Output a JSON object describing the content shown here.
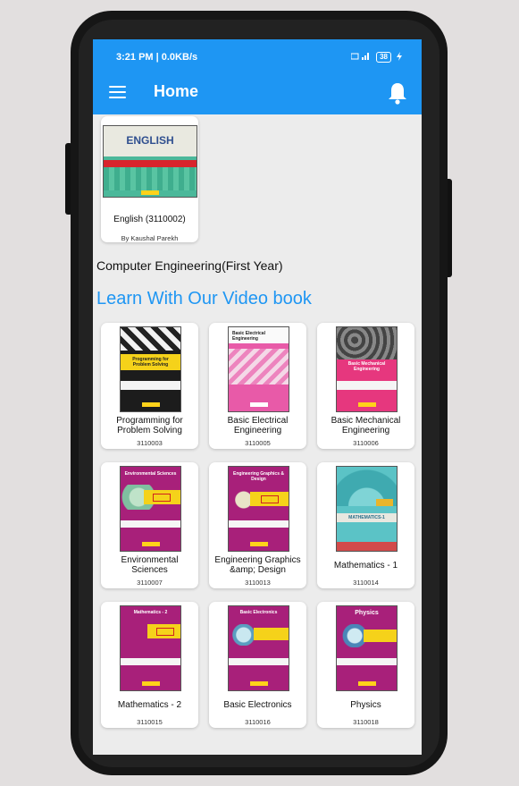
{
  "status_bar": {
    "time": "3:21 PM | 0.0KB/s",
    "battery": "38"
  },
  "toolbar": {
    "title": "Home"
  },
  "featured": {
    "cover_text": "ENGLISH",
    "name": "English (3110002)",
    "author": "By Kaushal Parekh"
  },
  "section_title": "Computer Engineering(First Year)",
  "video_section_title": "Learn With Our Video book",
  "books": [
    {
      "name": "Programming for Problem Solving",
      "code": "3110003",
      "cover_text": "Programming for Problem Solving"
    },
    {
      "name": "Basic Electrical Engineering",
      "code": "3110005",
      "cover_text": "Basic Electrical Engineering"
    },
    {
      "name": "Basic Mechanical Engineering",
      "code": "3110006",
      "cover_text": "Basic Mechanical Engineering"
    },
    {
      "name": "Environmental Sciences",
      "code": "3110007",
      "cover_text": "Environmental Sciences"
    },
    {
      "name": "Engineering Graphics &amp; Design",
      "code": "3110013",
      "cover_text": "Engineering Graphics & Design"
    },
    {
      "name": "Mathematics - 1",
      "code": "3110014",
      "cover_text": "MATHEMATICS-1"
    },
    {
      "name": "Mathematics - 2",
      "code": "3110015",
      "cover_text": "Mathematics - 2"
    },
    {
      "name": "Basic Electronics",
      "code": "3110016",
      "cover_text": "Basic Electronics"
    },
    {
      "name": "Physics",
      "code": "3110018",
      "cover_text": "Physics"
    }
  ],
  "colors": {
    "primary": "#1e96f3",
    "background": "#ececec",
    "cover_magenta": "#a8207a",
    "cover_yellow": "#f5d21a",
    "cover_pink": "#e85aa8",
    "cover_green": "#2fb080",
    "cover_teal": "#5bc3c6"
  },
  "icons": {
    "menu": "menu-icon",
    "notifications": "bell-icon"
  }
}
